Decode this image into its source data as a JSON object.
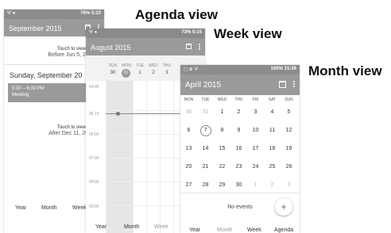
{
  "labels": {
    "agenda": "Agenda view",
    "week": "Week view",
    "month": "Month view"
  },
  "agenda": {
    "status": {
      "left": "Ψ ●",
      "battery": "76%",
      "time": "5:23"
    },
    "title": "September 2015",
    "touch1": "Touch to view",
    "before": "Before Jun 5, 2015",
    "date_header": "Sunday, September 20",
    "event_time": "5:30 – 6:30 PM",
    "event_title": "Meeting",
    "touch2": "Touch to view",
    "after": "After Dec 11, 2015",
    "nav": [
      "Year",
      "Month",
      "Week"
    ]
  },
  "week": {
    "status": {
      "left": "Ψ ●",
      "battery": "73%",
      "time": "5:15"
    },
    "title": "August 2015",
    "days": [
      {
        "d": "SUN",
        "n": "30"
      },
      {
        "d": "MON",
        "n": "31"
      },
      {
        "d": "TUE",
        "n": "1"
      },
      {
        "d": "WED",
        "n": "2"
      },
      {
        "d": "THU",
        "n": "3"
      }
    ],
    "times": [
      "04:00",
      "05:15",
      "06:00",
      "07:00",
      "08:00",
      "09:00"
    ],
    "nav": [
      "Year",
      "Month",
      "Week"
    ]
  },
  "month": {
    "status": {
      "left": "◻ ⊕ Ψ",
      "battery": "100%",
      "time": "15:26"
    },
    "title": "April 2015",
    "weekdays": [
      "MON",
      "TUE",
      "WED",
      "THU",
      "FRI",
      "SAT",
      "SUN"
    ],
    "weeks": [
      [
        "30",
        "31",
        "1",
        "2",
        "3",
        "4",
        "5"
      ],
      [
        "6",
        "7",
        "8",
        "9",
        "10",
        "11",
        "12"
      ],
      [
        "13",
        "14",
        "15",
        "16",
        "17",
        "18",
        "19"
      ],
      [
        "20",
        "21",
        "22",
        "23",
        "24",
        "25",
        "26"
      ],
      [
        "27",
        "28",
        "29",
        "30",
        "1",
        "2",
        "3"
      ]
    ],
    "no_events": "No events",
    "fab": "+",
    "nav": [
      "Year",
      "Month",
      "Week",
      "Agenda"
    ]
  }
}
